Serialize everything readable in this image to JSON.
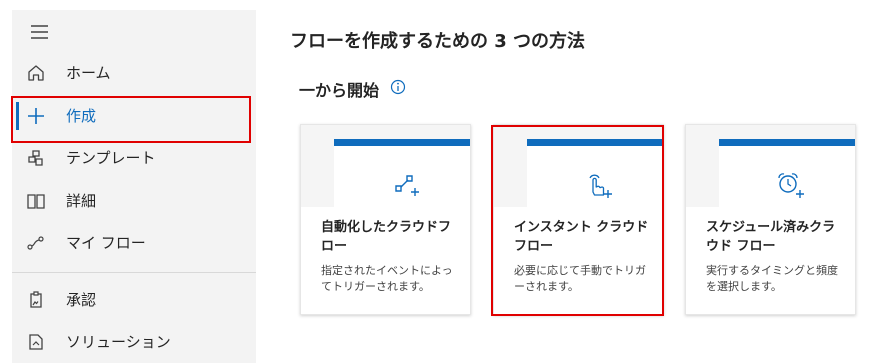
{
  "sidebar": {
    "items": [
      {
        "label": "ホーム",
        "icon": "home-icon"
      },
      {
        "label": "作成",
        "icon": "plus-icon",
        "active": true
      },
      {
        "label": "テンプレート",
        "icon": "template-icon"
      },
      {
        "label": "詳細",
        "icon": "book-icon"
      },
      {
        "label": "マイ フロー",
        "icon": "flow-icon"
      },
      {
        "label": "承認",
        "icon": "approval-icon"
      },
      {
        "label": "ソリューション",
        "icon": "solution-icon"
      }
    ]
  },
  "main": {
    "title": "フローを作成するための 3 つの方法",
    "section": "一から開始",
    "cards": [
      {
        "title": "自動化したクラウドフロー",
        "description": "指定されたイベントによってトリガーされます。",
        "icon": "automated-flow-icon"
      },
      {
        "title": "インスタント クラウドフロー",
        "description": "必要に応じて手動でトリガーされます。",
        "icon": "instant-touch-icon"
      },
      {
        "title": "スケジュール済みクラウド フロー",
        "description": "実行するタイミングと頻度を選択します。",
        "icon": "alarm-clock-icon"
      }
    ]
  },
  "colors": {
    "accent": "#0f6cbd",
    "highlight": "#e00000",
    "sidebar_bg": "#f3f3f3"
  }
}
